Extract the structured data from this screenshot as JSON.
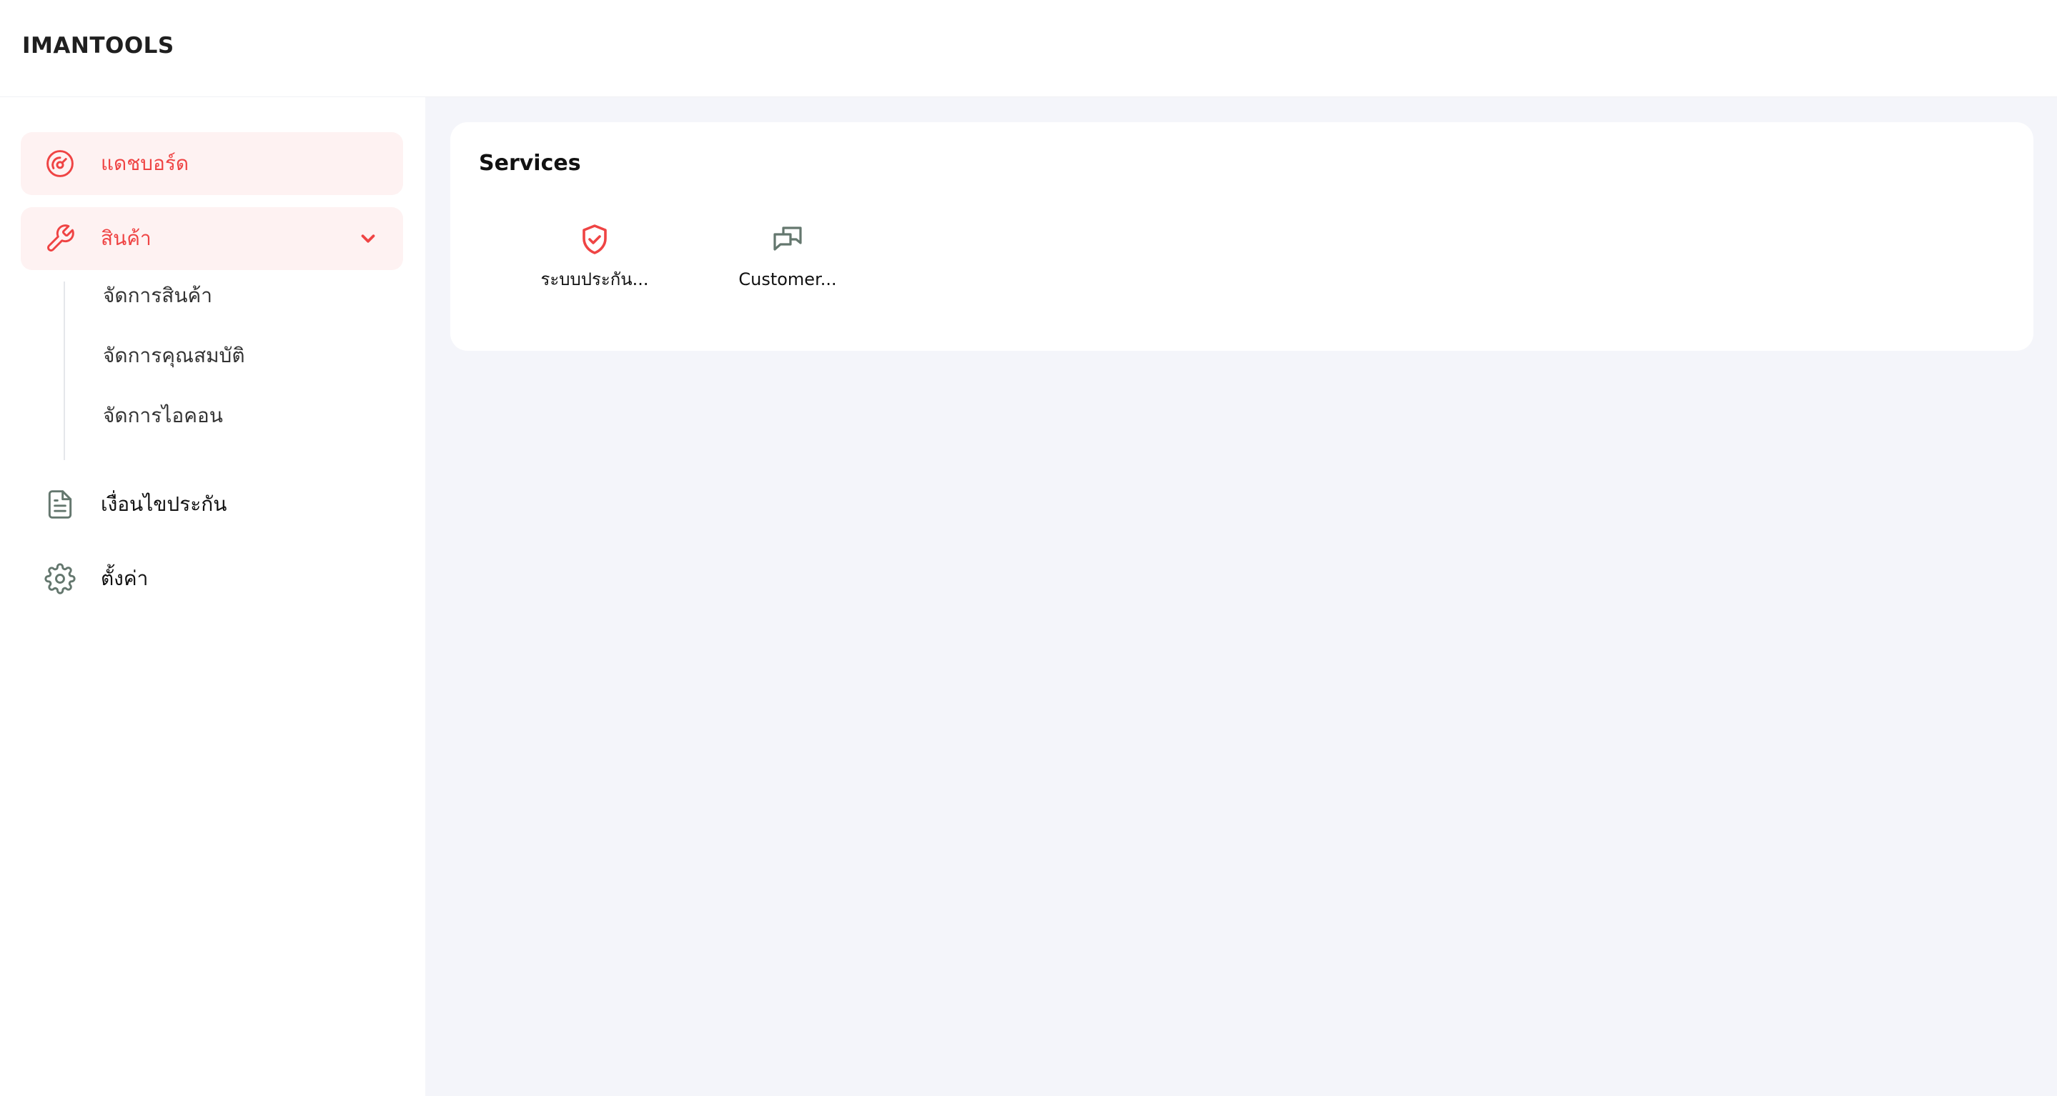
{
  "app": {
    "brand": "IMANTOOLS"
  },
  "colors": {
    "accent": "#ef4444",
    "active_bg": "#fef2f2",
    "icon_gray": "#64776e",
    "main_bg": "#f4f5fa"
  },
  "sidebar": {
    "items": [
      {
        "label": "แดชบอร์ด",
        "icon": "dashboard-gauge-icon",
        "active": true
      },
      {
        "label": "สินค้า",
        "icon": "wrench-icon",
        "active": true,
        "expanded": true,
        "children": [
          {
            "label": "จัดการสินค้า"
          },
          {
            "label": "จัดการคุณสมบัติ"
          },
          {
            "label": "จัดการไอคอน"
          }
        ]
      },
      {
        "label": "เงื่อนไขประกัน",
        "icon": "document-icon",
        "active": false
      },
      {
        "label": "ตั้งค่า",
        "icon": "gear-icon",
        "active": false
      }
    ]
  },
  "main": {
    "card": {
      "title": "Services",
      "services": [
        {
          "label": "ระบบประกัน...",
          "icon": "shield-check-icon"
        },
        {
          "label": "Customer...",
          "icon": "chat-bubbles-icon"
        }
      ]
    }
  }
}
